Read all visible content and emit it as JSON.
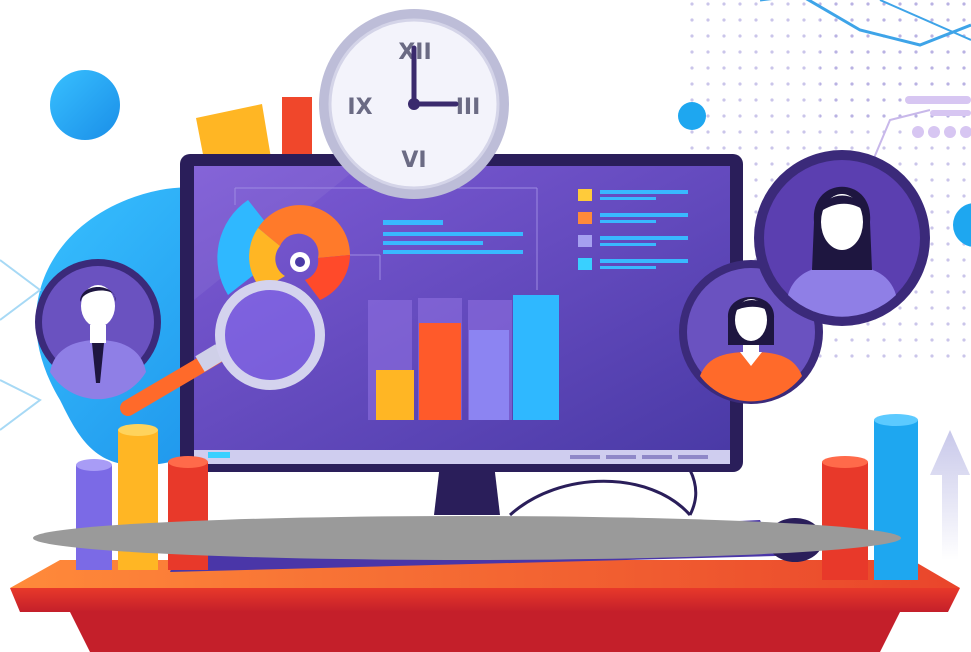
{
  "clock": {
    "numerals": {
      "top": "XII",
      "right": "III",
      "bottom": "VI",
      "left": "IX"
    }
  },
  "colors": {
    "background": "#ffffff",
    "blob_blue": "#1ea7f0",
    "monitor_frame": "#3a2a6d",
    "screen": "#6a4fc2",
    "desk_top": "#f26a2b",
    "desk_front": "#e8392a",
    "overlay_ellipse": "#9a9a9a"
  },
  "icons": {
    "clock": "clock-icon",
    "magnifier": "magnifier-icon",
    "avatars": [
      "male-avatar-icon",
      "female-avatar-icon",
      "female-avatar-icon"
    ],
    "arrow": "up-arrow-icon"
  }
}
